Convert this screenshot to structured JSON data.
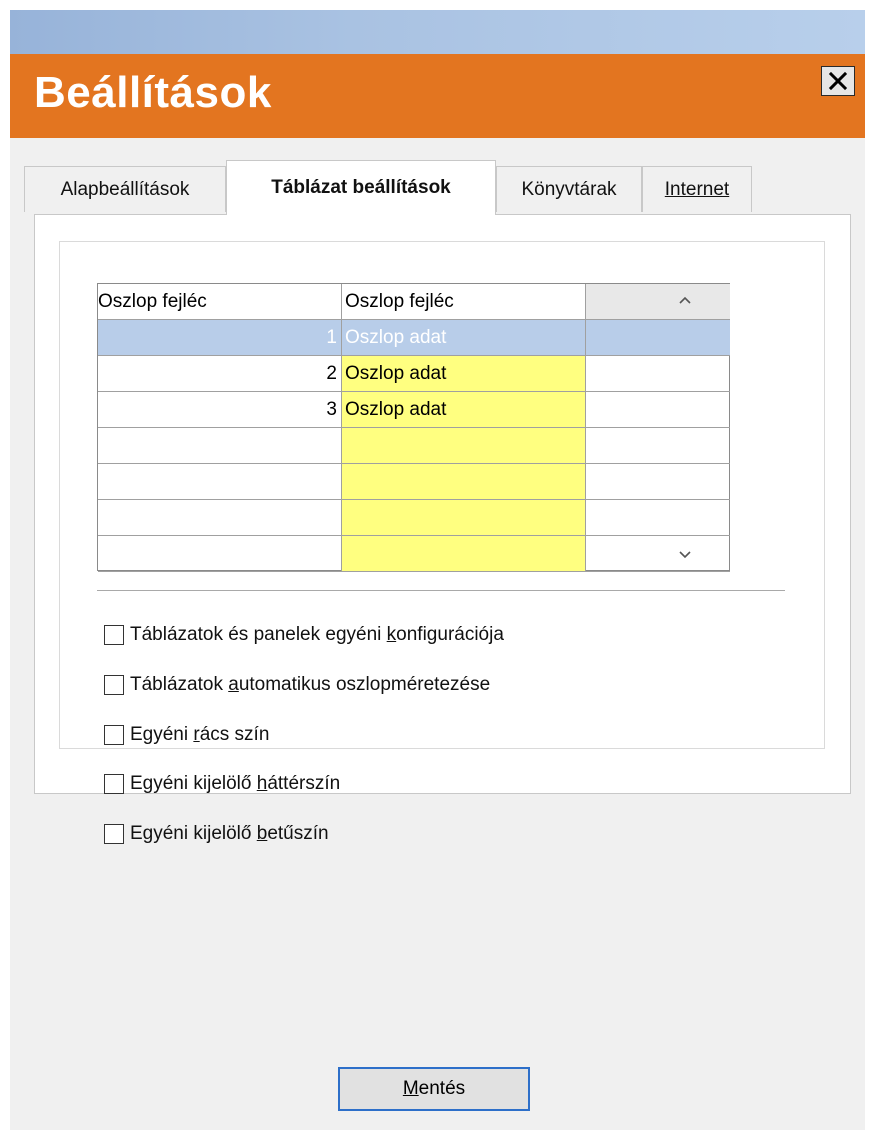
{
  "window": {
    "title": "Beállítások"
  },
  "tabs": [
    {
      "label": "Alapbeállítások",
      "active": false
    },
    {
      "label": "Táblázat beállítások",
      "active": true
    },
    {
      "label": "Könyvtárak",
      "active": false
    },
    {
      "label": "Internet",
      "active": false
    }
  ],
  "grid": {
    "headers": [
      "Oszlop fejléc",
      "Oszlop fejléc",
      ""
    ],
    "rows": [
      {
        "num": "1",
        "text": "Oszlop adat",
        "selected": true
      },
      {
        "num": "2",
        "text": "Oszlop adat",
        "selected": false
      },
      {
        "num": "3",
        "text": "Oszlop adat",
        "selected": false
      },
      {
        "num": "",
        "text": "",
        "selected": false
      },
      {
        "num": "",
        "text": "",
        "selected": false
      },
      {
        "num": "",
        "text": "",
        "selected": false
      },
      {
        "num": "",
        "text": "",
        "selected": false
      }
    ],
    "scroll_up_icon": "chevron-up-icon",
    "scroll_down_icon": "chevron-down-icon"
  },
  "options": [
    {
      "before": "Táblázatok és panelek egyéni ",
      "key": "k",
      "after": "onfigurációja",
      "checked": false
    },
    {
      "before": "Táblázatok ",
      "key": "a",
      "after": "utomatikus oszlopméretezése",
      "checked": false
    },
    {
      "before": "Egyéni ",
      "key": "r",
      "after": "ács szín",
      "checked": false
    },
    {
      "before": "Egyéni kijelölő ",
      "key": "h",
      "after": "áttérszín",
      "checked": false
    },
    {
      "before": "Egyéni kijelölő ",
      "key": "b",
      "after": "etűszín",
      "checked": false
    }
  ],
  "footer": {
    "save_key": "M",
    "save_rest": "entés"
  },
  "colors": {
    "title_bar": "#e37520",
    "top_strip": "#a9c2e2",
    "grid_column_highlight": "#ffff80",
    "selection": "#b8cde9",
    "button_focus": "#2d6fc9"
  }
}
